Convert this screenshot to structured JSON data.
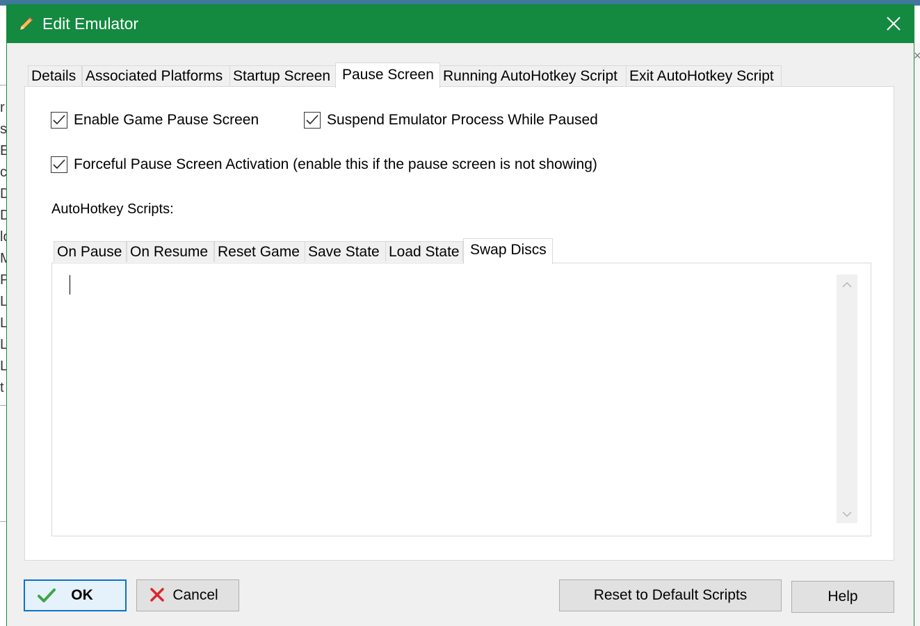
{
  "window": {
    "title": "Edit Emulator",
    "title_color": "#138a3f",
    "title_icon": "pencil-icon",
    "close_icon": "close-icon"
  },
  "background": {
    "left_letters": [
      "r",
      "s",
      "EB",
      "ch",
      "De",
      "Do",
      "lo",
      "MA",
      "Pl",
      "Le",
      "Le",
      "Le",
      "Le",
      "t"
    ]
  },
  "tabs": [
    {
      "label": "Details",
      "active": false
    },
    {
      "label": "Associated Platforms",
      "active": false
    },
    {
      "label": "Startup Screen",
      "active": false
    },
    {
      "label": "Pause Screen",
      "active": true
    },
    {
      "label": "Running AutoHotkey Script",
      "active": false
    },
    {
      "label": "Exit AutoHotkey Script",
      "active": false
    }
  ],
  "options": {
    "enable_pause_screen": {
      "label": "Enable Game Pause Screen",
      "checked": true
    },
    "suspend_process": {
      "label": "Suspend Emulator Process While Paused",
      "checked": true
    },
    "forceful_activation": {
      "label": "Forceful Pause Screen Activation (enable this if the pause screen is not showing)",
      "checked": true
    }
  },
  "scripts": {
    "label": "AutoHotkey Scripts:",
    "tabs": [
      {
        "label": "On Pause",
        "active": false
      },
      {
        "label": "On Resume",
        "active": false
      },
      {
        "label": "Reset Game",
        "active": false
      },
      {
        "label": "Save State",
        "active": false
      },
      {
        "label": "Load State",
        "active": false
      },
      {
        "label": "Swap Discs",
        "active": true
      }
    ],
    "editor_value": ""
  },
  "buttons": {
    "ok": {
      "label": "OK",
      "icon": "checkmark-icon",
      "icon_color": "#3aa845"
    },
    "cancel": {
      "label": "Cancel",
      "icon": "red-x-icon",
      "icon_color": "#d9262b"
    },
    "reset": {
      "label": "Reset to Default Scripts"
    },
    "help": {
      "label": "Help"
    }
  }
}
